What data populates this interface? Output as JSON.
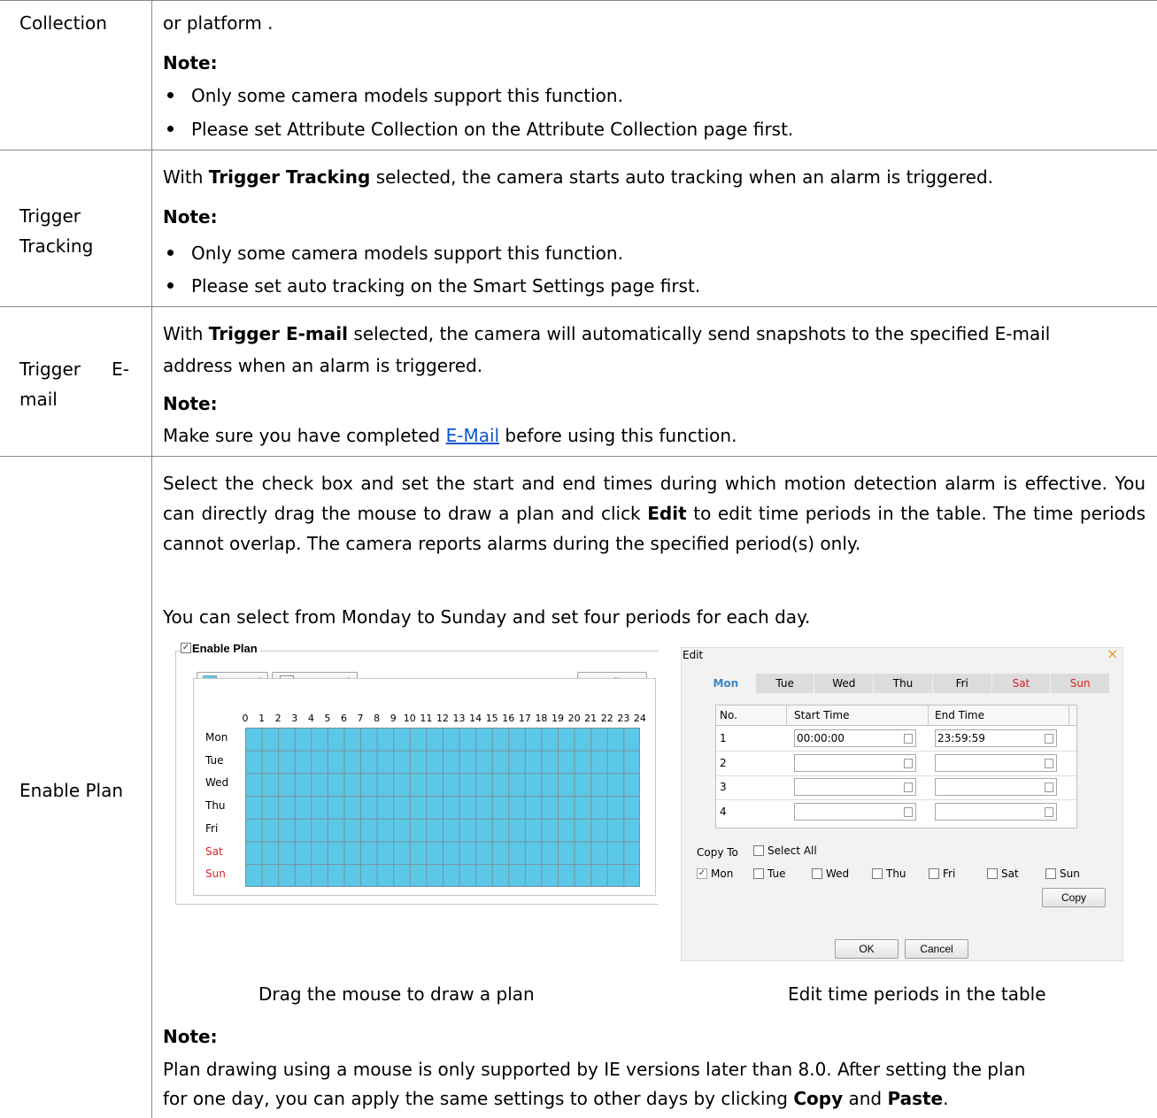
{
  "rows": [
    {
      "label": "Collection",
      "text": "or platform .",
      "note_label": "Note:",
      "bullets": [
        "Only some camera models support this function.",
        "Please set Attribute Collection on the Attribute Collection page first."
      ]
    },
    {
      "label_line1": "Trigger",
      "label_line2": "Tracking",
      "text_prefix": "With ",
      "text_bold": "Trigger Tracking",
      "text_suffix": " selected, the camera starts auto tracking when an alarm is triggered.",
      "note_label": "Note:",
      "bullets": [
        "Only some camera models support this function.",
        "Please set auto tracking on the Smart Settings page first."
      ]
    },
    {
      "label_line1a": "Trigger",
      "label_line1b": "E-",
      "label_line2": "mail",
      "text_prefix": "With ",
      "text_bold": "Trigger E-mail",
      "text_line1_suffix": " selected, the camera will automatically send snapshots to the specified E-mail",
      "text_line2": "address when an alarm is triggered.",
      "note_label": "Note:",
      "note_prefix": "Make sure you have completed ",
      "note_link": "E-Mail",
      "note_suffix": " before using this function."
    },
    {
      "label": "Enable Plan",
      "p1_a": "Select the check box and set the start and end times during which motion detection alarm is effective. You can directly drag the mouse to draw a plan and click ",
      "p1_bold": "Edit",
      "p1_b": " to edit time periods in the table. The time periods cannot overlap. The camera reports alarms during the specified period(s) only.",
      "p2": "You can select from Monday to Sunday and set four periods for each day.",
      "caption_left": "Drag the mouse to draw a plan",
      "caption_right": "Edit time periods in the table",
      "note_label": "Note:",
      "note_line1": "Plan drawing using a mouse is only supported by IE versions later than 8.0. After setting the plan",
      "note_line2_a": "for one day, you can apply the same settings to other days by clicking ",
      "note_copy": "Copy",
      "note_and": " and ",
      "note_paste": "Paste",
      "note_end": "."
    }
  ],
  "plan_widget": {
    "legend": "Enable Plan",
    "armed": "Armed",
    "unarmed": "Unarmed",
    "edit": "Edit",
    "hours": [
      "0",
      "1",
      "2",
      "3",
      "4",
      "5",
      "6",
      "7",
      "8",
      "9",
      "10",
      "11",
      "12",
      "13",
      "14",
      "15",
      "16",
      "17",
      "18",
      "19",
      "20",
      "21",
      "22",
      "23",
      "24"
    ],
    "days": [
      "Mon",
      "Tue",
      "Wed",
      "Thu",
      "Fri",
      "Sat",
      "Sun"
    ],
    "armed_color": "#5bc8e8"
  },
  "edit_dialog": {
    "title": "Edit",
    "close": "×",
    "tabs": [
      "Mon",
      "Tue",
      "Wed",
      "Thu",
      "Fri",
      "Sat",
      "Sun"
    ],
    "col_no": "No.",
    "col_start": "Start Time",
    "col_end": "End Time",
    "rows": [
      {
        "no": "1",
        "start": "00:00:00",
        "end": "23:59:59"
      },
      {
        "no": "2",
        "start": "",
        "end": ""
      },
      {
        "no": "3",
        "start": "",
        "end": ""
      },
      {
        "no": "4",
        "start": "",
        "end": ""
      }
    ],
    "copy_to": "Copy To",
    "select_all": "Select All",
    "copy_days": [
      "Mon",
      "Tue",
      "Wed",
      "Thu",
      "Fri",
      "Sat",
      "Sun"
    ],
    "copy": "Copy",
    "ok": "OK",
    "cancel": "Cancel"
  }
}
